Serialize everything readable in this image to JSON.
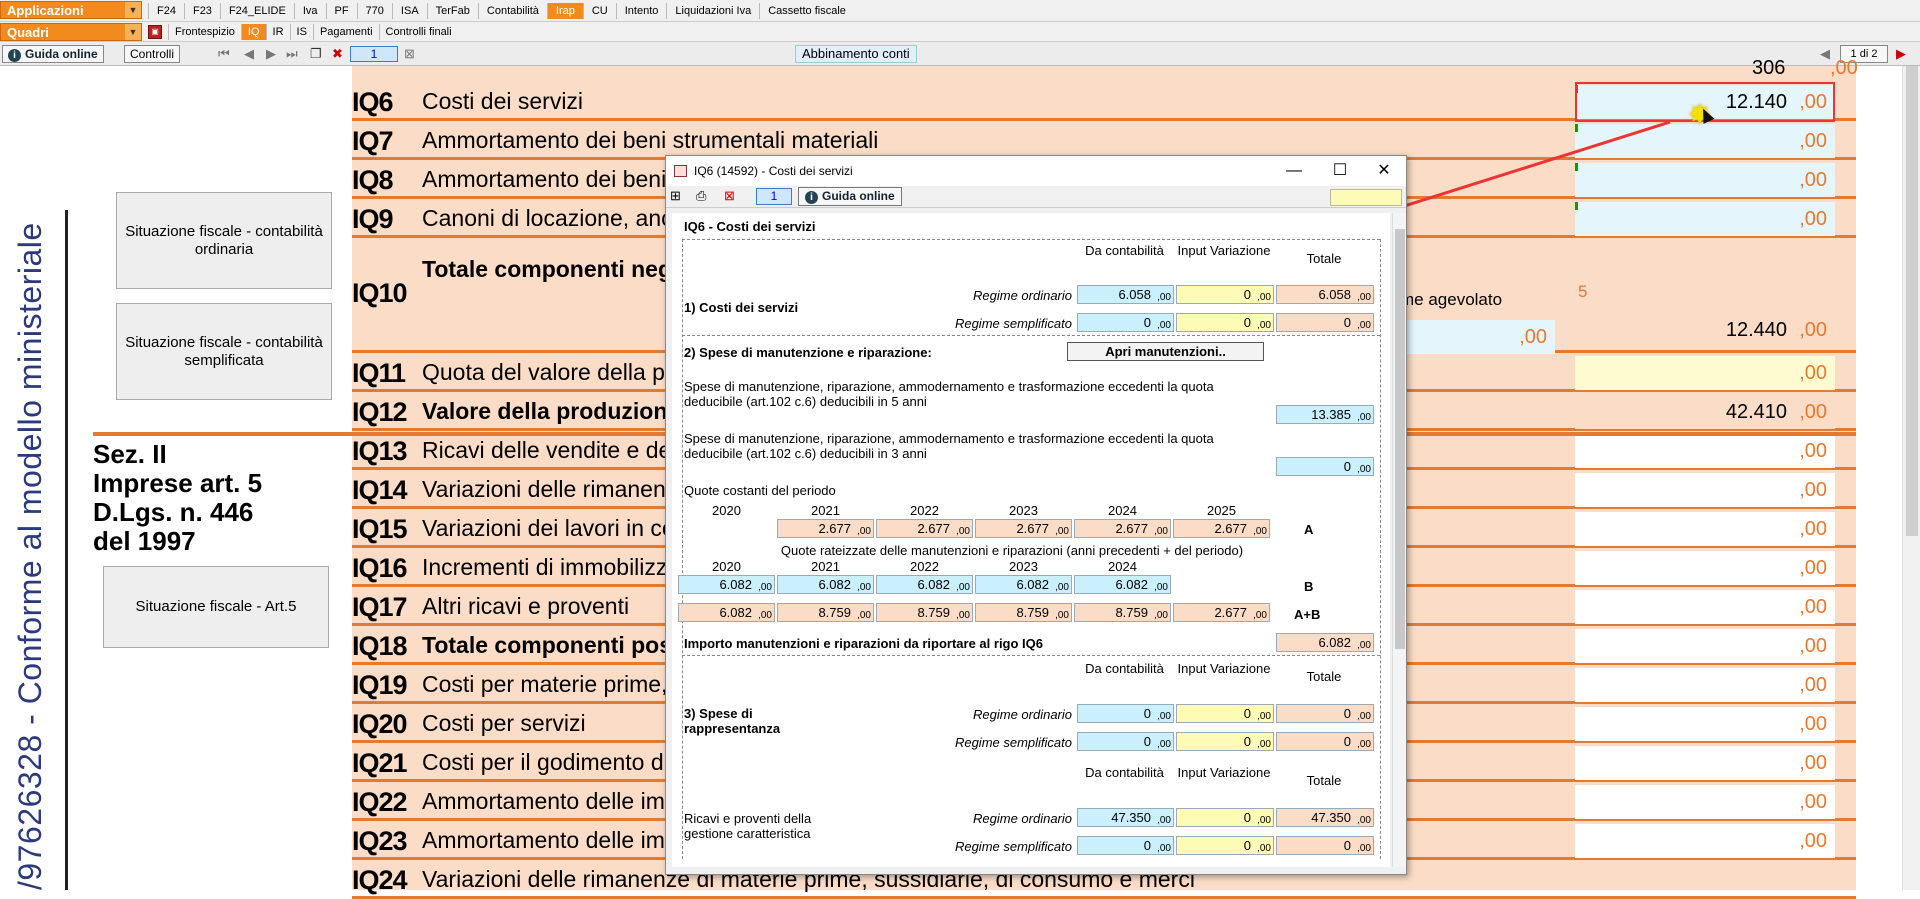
{
  "menubar": {
    "applicazioni": "Applicazioni",
    "tabs": [
      "F24",
      "F23",
      "F24_ELIDE",
      "Iva",
      "PF",
      "770",
      "ISA",
      "TerFab",
      "Contabilità",
      "Irap",
      "CU",
      "Intento",
      "Liquidazioni Iva",
      "Cassetto fiscale"
    ],
    "active": "Irap"
  },
  "quadribar": {
    "quadri": "Quadri",
    "tabs": [
      "Frontespizio",
      "IQ",
      "IR",
      "IS",
      "Pagamenti",
      "Controlli finali"
    ],
    "active": "IQ"
  },
  "toolbar": {
    "guida": "Guida online",
    "controlli": "Controlli",
    "page": "1",
    "abbinamento": "Abbinamento conti",
    "pages": "1 di 2"
  },
  "side": {
    "vertical_text": "/97626328 - Conforme al modello ministeriale",
    "btn_ord": "Situazione fiscale - contabilità ordinaria",
    "btn_sem": "Situazione fiscale - contabilità semplificata",
    "btn_art5": "Situazione fiscale - Art.5",
    "sez_lines": [
      "Sez. II",
      "Imprese art. 5",
      "D.Lgs. n. 446",
      "del 1997"
    ]
  },
  "form": {
    "top_partial_value": "306",
    "rows": [
      {
        "code": "IQ6",
        "desc": "Costi dei servizi",
        "value": "12.140",
        "dec": ",00"
      },
      {
        "code": "IQ7",
        "desc": "Ammortamento dei beni strumentali materiali",
        "value": "",
        "dec": ",00"
      },
      {
        "code": "IQ8",
        "desc": "Ammortamento dei beni s",
        "value": "",
        "dec": ",00"
      },
      {
        "code": "IQ9",
        "desc": "Canoni di locazione, anc",
        "value": "",
        "dec": ",00"
      },
      {
        "code": "IQ10",
        "desc": "Totale componenti negat",
        "value": "12.440",
        "dec": ",00"
      },
      {
        "code": "IQ11",
        "desc": "Quota del valore della pr",
        "value": "",
        "dec": ",00"
      },
      {
        "code": "IQ12",
        "desc": "Valore della produzione",
        "value": "42.410",
        "dec": ",00"
      },
      {
        "code": "IQ13",
        "desc": "Ricavi delle vendite e dell",
        "value": "",
        "dec": ",00"
      },
      {
        "code": "IQ14",
        "desc": "Variazioni delle rimanenz",
        "value": "",
        "dec": ",00"
      },
      {
        "code": "IQ15",
        "desc": "Variazioni dei lavori in co",
        "value": "",
        "dec": ",00"
      },
      {
        "code": "IQ16",
        "desc": "Incrementi di immobilizzo",
        "value": "",
        "dec": ",00"
      },
      {
        "code": "IQ17",
        "desc": "Altri ricavi e proventi",
        "value": "",
        "dec": ",00"
      },
      {
        "code": "IQ18",
        "desc": "Totale componenti positiv",
        "value": "",
        "dec": ",00"
      },
      {
        "code": "IQ19",
        "desc": "Costi per materie prime, s",
        "value": "",
        "dec": ",00"
      },
      {
        "code": "IQ20",
        "desc": "Costi per servizi",
        "value": "",
        "dec": ",00"
      },
      {
        "code": "IQ21",
        "desc": "Costi per il godimento di",
        "value": "",
        "dec": ",00"
      },
      {
        "code": "IQ22",
        "desc": "Ammortamento delle imm",
        "value": "",
        "dec": ",00"
      },
      {
        "code": "IQ23",
        "desc": "Ammortamento delle imm",
        "value": "",
        "dec": ",00"
      },
      {
        "code": "IQ24",
        "desc": "Variazioni delle rimanenze di materie prime, sussidiarie, di consumo e merci",
        "value": "",
        "dec": ""
      }
    ],
    "iq10_extra": "me agevolato",
    "iq10_5": "5",
    "iq10_mid_dec": ",00"
  },
  "dialog": {
    "title": "IQ6 (14592) - Costi dei servizi",
    "page": "1",
    "guida": "Guida online",
    "heading": "IQ6 - Costi dei servizi",
    "col_da": "Da contabilità",
    "col_input": "Input Variazione",
    "col_tot": "Totale",
    "s1": "1) Costi dei servizi",
    "regime_ord": "Regime ordinario",
    "regime_sem": "Regime semplificato",
    "s1_ord": [
      "6.058",
      "0",
      "6.058"
    ],
    "s1_sem": [
      "0",
      "0",
      "0"
    ],
    "s2": "2) Spese di manutenzione e riparazione:",
    "apri": "Apri manutenzioni..",
    "spese5": "Spese di manutenzione, riparazione, ammodernamento e trasformazione eccedenti la quota deducibile (art.102 c.6) deducibili in 5 anni",
    "spese5_val": "13.385",
    "spese3": "Spese di manutenzione, riparazione, ammodernamento e trasformazione eccedenti la quota deducibile (art.102 c.6) deducibili in 3 anni",
    "spese3_val": "0",
    "quote_costanti": "Quote costanti del periodo",
    "years5": [
      "2020",
      "2021",
      "2022",
      "2023",
      "2024",
      "2025"
    ],
    "rowA": [
      "2.677",
      "2.677",
      "2.677",
      "2.677",
      "2.677"
    ],
    "labelA": "A",
    "quote_rateizzate": "Quote rateizzate delle manutenzioni e riparazioni (anni precedenti + del periodo)",
    "rowB": [
      "6.082",
      "6.082",
      "6.082",
      "6.082",
      "6.082"
    ],
    "labelB": "B",
    "rowAB": [
      "6.082",
      "8.759",
      "8.759",
      "8.759",
      "8.759",
      "2.677"
    ],
    "labelAB": "A+B",
    "importo": "Importo manutenzioni e riparazioni da riportare al rigo IQ6",
    "importo_val": "6.082",
    "s3": "3) Spese di rappresentanza",
    "s3_ord": [
      "0",
      "0",
      "0"
    ],
    "s3_sem": [
      "0",
      "0",
      "0"
    ],
    "ricavi": "Ricavi e proventi della gestione caratteristica",
    "ric_ord": [
      "47.350",
      "0",
      "47.350"
    ],
    "ric_sem": [
      "0",
      "0",
      "0"
    ],
    "dec": ",00"
  }
}
